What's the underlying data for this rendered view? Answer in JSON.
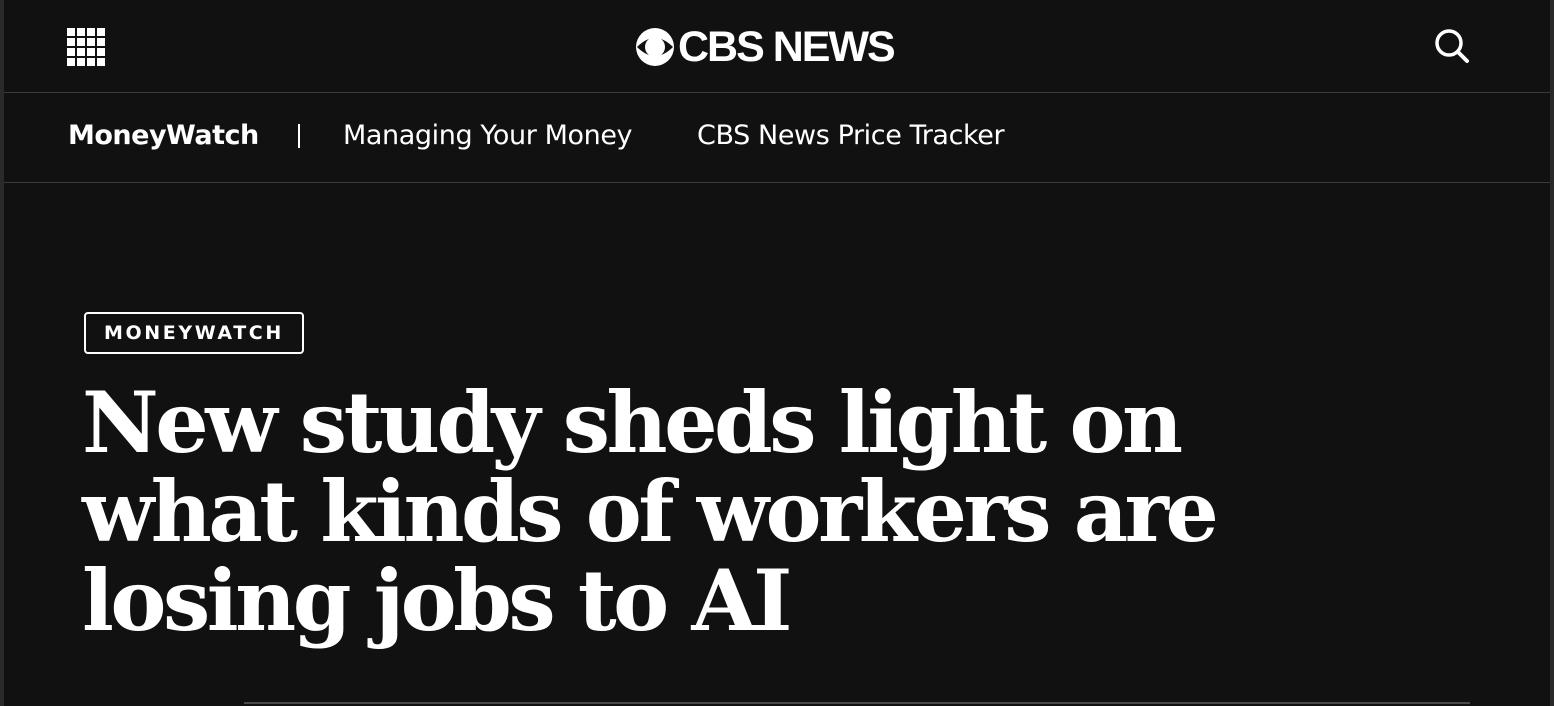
{
  "header": {
    "menu_icon": "grid-menu-icon",
    "logo_icon": "cbs-eye-icon",
    "logo_text": "CBS NEWS",
    "search_icon": "search-icon"
  },
  "subnav": {
    "brand": "MoneyWatch",
    "links": [
      {
        "label": "Managing Your Money"
      },
      {
        "label": "CBS News Price Tracker"
      }
    ]
  },
  "article": {
    "category_badge": "MONEYWATCH",
    "headline": "New study sheds light on what kinds of workers are losing jobs to AI"
  },
  "colors": {
    "background": "#111111",
    "text": "#ffffff",
    "divider": "#3a3a3a"
  }
}
